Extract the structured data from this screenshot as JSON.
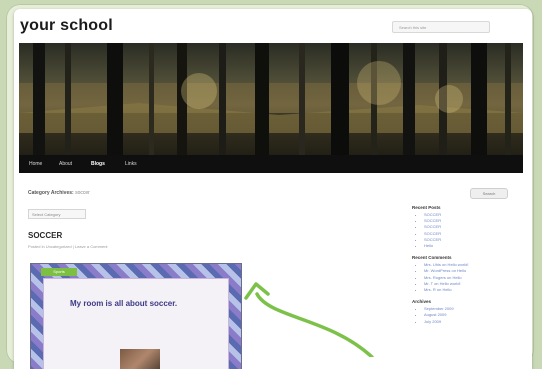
{
  "site": {
    "title": "your school",
    "search_placeholder": "Search this site"
  },
  "nav": {
    "items": [
      "Home",
      "About",
      "Blogs",
      "Links"
    ],
    "active_index": 2
  },
  "archive": {
    "label": "Category Archives:",
    "value": "soccer"
  },
  "search_button": {
    "label": "Search"
  },
  "dropdown": {
    "label": "Select Category"
  },
  "post": {
    "title": "SOCCER",
    "meta": "Posted in Uncategorized | Leave a Comment",
    "image_tag": "Sports",
    "image_title": "My room is all about soccer."
  },
  "sidebar": {
    "recent_posts": {
      "heading": "Recent Posts",
      "items": [
        "SOCCER",
        "SOCCER",
        "SOCCER",
        "SOCCER",
        "SOCCER",
        "Hello"
      ]
    },
    "recent_comments": {
      "heading": "Recent Comments",
      "items": [
        "Mrs. Uhls on Hello world!",
        "Mr. WordPress on Hello",
        "Mrs. Rogers on Hello",
        "Mr. T on Hello world!",
        "Mrs. R on Hello"
      ]
    },
    "archives": {
      "heading": "Archives",
      "items": [
        "September 2009",
        "August 2009",
        "July 2009"
      ]
    }
  },
  "colors": {
    "background": "#c9d9b6",
    "arrow": "#7cc24a",
    "nav": "#0f0f0f",
    "link": "#6f86c7"
  }
}
